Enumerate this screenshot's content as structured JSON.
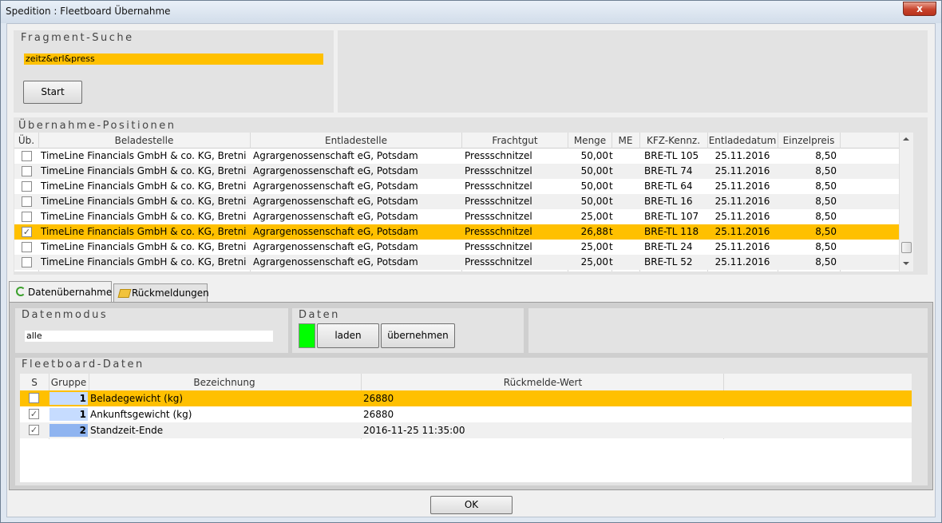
{
  "window": {
    "title": "Spedition : Fleetboard Übernahme",
    "close_label": "x"
  },
  "fragment": {
    "caption": "Fragment-Suche",
    "value": "zeitz&erl&press",
    "start_label": "Start"
  },
  "positions": {
    "caption": "Übernahme-Positionen",
    "headers": [
      "Üb.",
      "Beladestelle",
      "Entladestelle",
      "Frachtgut",
      "Menge",
      "ME",
      "KFZ-Kennz.",
      "Entladedatum",
      "Einzelpreis"
    ],
    "rows": [
      {
        "checked": false,
        "selected": false,
        "beladestelle": "TimeLine Financials GmbH & co. KG, Bretnig",
        "entladestelle": "Agrargenossenschaft eG, Potsdam",
        "frachtgut": "Pressschnitzel",
        "menge": "50,00",
        "me": "t",
        "kfz": "BRE-TL 105",
        "datum": "25.11.2016",
        "preis": "8,50"
      },
      {
        "checked": false,
        "selected": false,
        "beladestelle": "TimeLine Financials GmbH & co. KG, Bretnig",
        "entladestelle": "Agrargenossenschaft eG, Potsdam",
        "frachtgut": "Pressschnitzel",
        "menge": "50,00",
        "me": "t",
        "kfz": "BRE-TL 74",
        "datum": "25.11.2016",
        "preis": "8,50"
      },
      {
        "checked": false,
        "selected": false,
        "beladestelle": "TimeLine Financials GmbH & co. KG, Bretnig",
        "entladestelle": "Agrargenossenschaft eG, Potsdam",
        "frachtgut": "Pressschnitzel",
        "menge": "50,00",
        "me": "t",
        "kfz": "BRE-TL 64",
        "datum": "25.11.2016",
        "preis": "8,50"
      },
      {
        "checked": false,
        "selected": false,
        "beladestelle": "TimeLine Financials GmbH & co. KG, Bretnig",
        "entladestelle": "Agrargenossenschaft eG, Potsdam",
        "frachtgut": "Pressschnitzel",
        "menge": "50,00",
        "me": "t",
        "kfz": "BRE-TL 16",
        "datum": "25.11.2016",
        "preis": "8,50"
      },
      {
        "checked": false,
        "selected": false,
        "beladestelle": "TimeLine Financials GmbH & co. KG, Bretnig",
        "entladestelle": "Agrargenossenschaft eG, Potsdam",
        "frachtgut": "Pressschnitzel",
        "menge": "25,00",
        "me": "t",
        "kfz": "BRE-TL 107",
        "datum": "25.11.2016",
        "preis": "8,50"
      },
      {
        "checked": true,
        "selected": true,
        "beladestelle": "TimeLine Financials GmbH & co. KG, Bretnig",
        "entladestelle": "Agrargenossenschaft eG, Potsdam",
        "frachtgut": "Pressschnitzel",
        "menge": "26,88",
        "me": "t",
        "kfz": "BRE-TL 118",
        "datum": "25.11.2016",
        "preis": "8,50"
      },
      {
        "checked": false,
        "selected": false,
        "beladestelle": "TimeLine Financials GmbH & co. KG, Bretnig",
        "entladestelle": "Agrargenossenschaft eG, Potsdam",
        "frachtgut": "Pressschnitzel",
        "menge": "25,00",
        "me": "t",
        "kfz": "BRE-TL 24",
        "datum": "25.11.2016",
        "preis": "8,50"
      },
      {
        "checked": false,
        "selected": false,
        "beladestelle": "TimeLine Financials GmbH & co. KG, Bretnig",
        "entladestelle": "Agrargenossenschaft eG, Potsdam",
        "frachtgut": "Pressschnitzel",
        "menge": "25,00",
        "me": "t",
        "kfz": "BRE-TL 52",
        "datum": "25.11.2016",
        "preis": "8,50"
      }
    ]
  },
  "tabs": [
    {
      "label": "Datenübernahme",
      "icon": "refresh-icon",
      "active": true
    },
    {
      "label": "Rückmeldungen",
      "icon": "folder-icon",
      "active": false
    }
  ],
  "datenmodus": {
    "caption": "Datenmodus",
    "value": "alle"
  },
  "daten": {
    "caption": "Daten",
    "indicator_color": "#00ff00",
    "laden_label": "laden",
    "uebernehmen_label": "übernehmen"
  },
  "fleetboard": {
    "caption": "Fleetboard-Daten",
    "headers": [
      "S",
      "Gruppe",
      "Bezeichnung",
      "Rückmelde-Wert"
    ],
    "rows": [
      {
        "checked": false,
        "selected": true,
        "gruppe": "1",
        "gruppe_color": "#c6dcff",
        "bezeichnung": "Beladegewicht (kg)",
        "wert": "26880"
      },
      {
        "checked": true,
        "selected": false,
        "gruppe": "1",
        "gruppe_color": "#c6dcff",
        "bezeichnung": "Ankunftsgewicht (kg)",
        "wert": "26880"
      },
      {
        "checked": true,
        "selected": false,
        "gruppe": "2",
        "gruppe_color": "#8fb4f0",
        "bezeichnung": "Standzeit-Ende",
        "wert": "2016-11-25 11:35:00"
      }
    ]
  },
  "footer": {
    "ok_label": "OK"
  },
  "colors": {
    "selection": "#ffc000",
    "row_alt": "#f0f0f0"
  }
}
